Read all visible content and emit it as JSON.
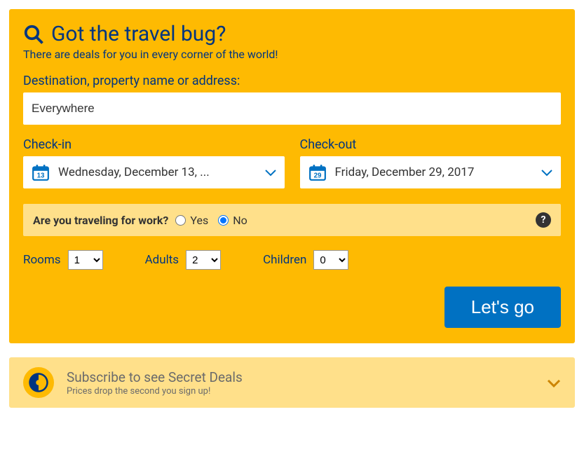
{
  "search": {
    "heading": "Got the travel bug?",
    "subheading": "There are deals for you in every corner of the world!",
    "destination_label": "Destination, property name or address:",
    "destination_value": "Everywhere",
    "checkin_label": "Check-in",
    "checkin_day": "13",
    "checkin_text": "Wednesday, December 13, ...",
    "checkout_label": "Check-out",
    "checkout_day": "29",
    "checkout_text": "Friday, December 29, 2017"
  },
  "work": {
    "question": "Are you traveling for work?",
    "yes": "Yes",
    "no": "No",
    "selected": "no"
  },
  "counters": {
    "rooms_label": "Rooms",
    "rooms_value": "1",
    "adults_label": "Adults",
    "adults_value": "2",
    "children_label": "Children",
    "children_value": "0"
  },
  "go_button": "Let's go",
  "subscribe": {
    "title": "Subscribe to see Secret Deals",
    "subtitle": "Prices drop the second you sign up!"
  },
  "colors": {
    "brand_blue": "#003580",
    "action_blue": "#0071c2",
    "yellow": "#feba02",
    "pale_yellow": "#ffe08a"
  }
}
